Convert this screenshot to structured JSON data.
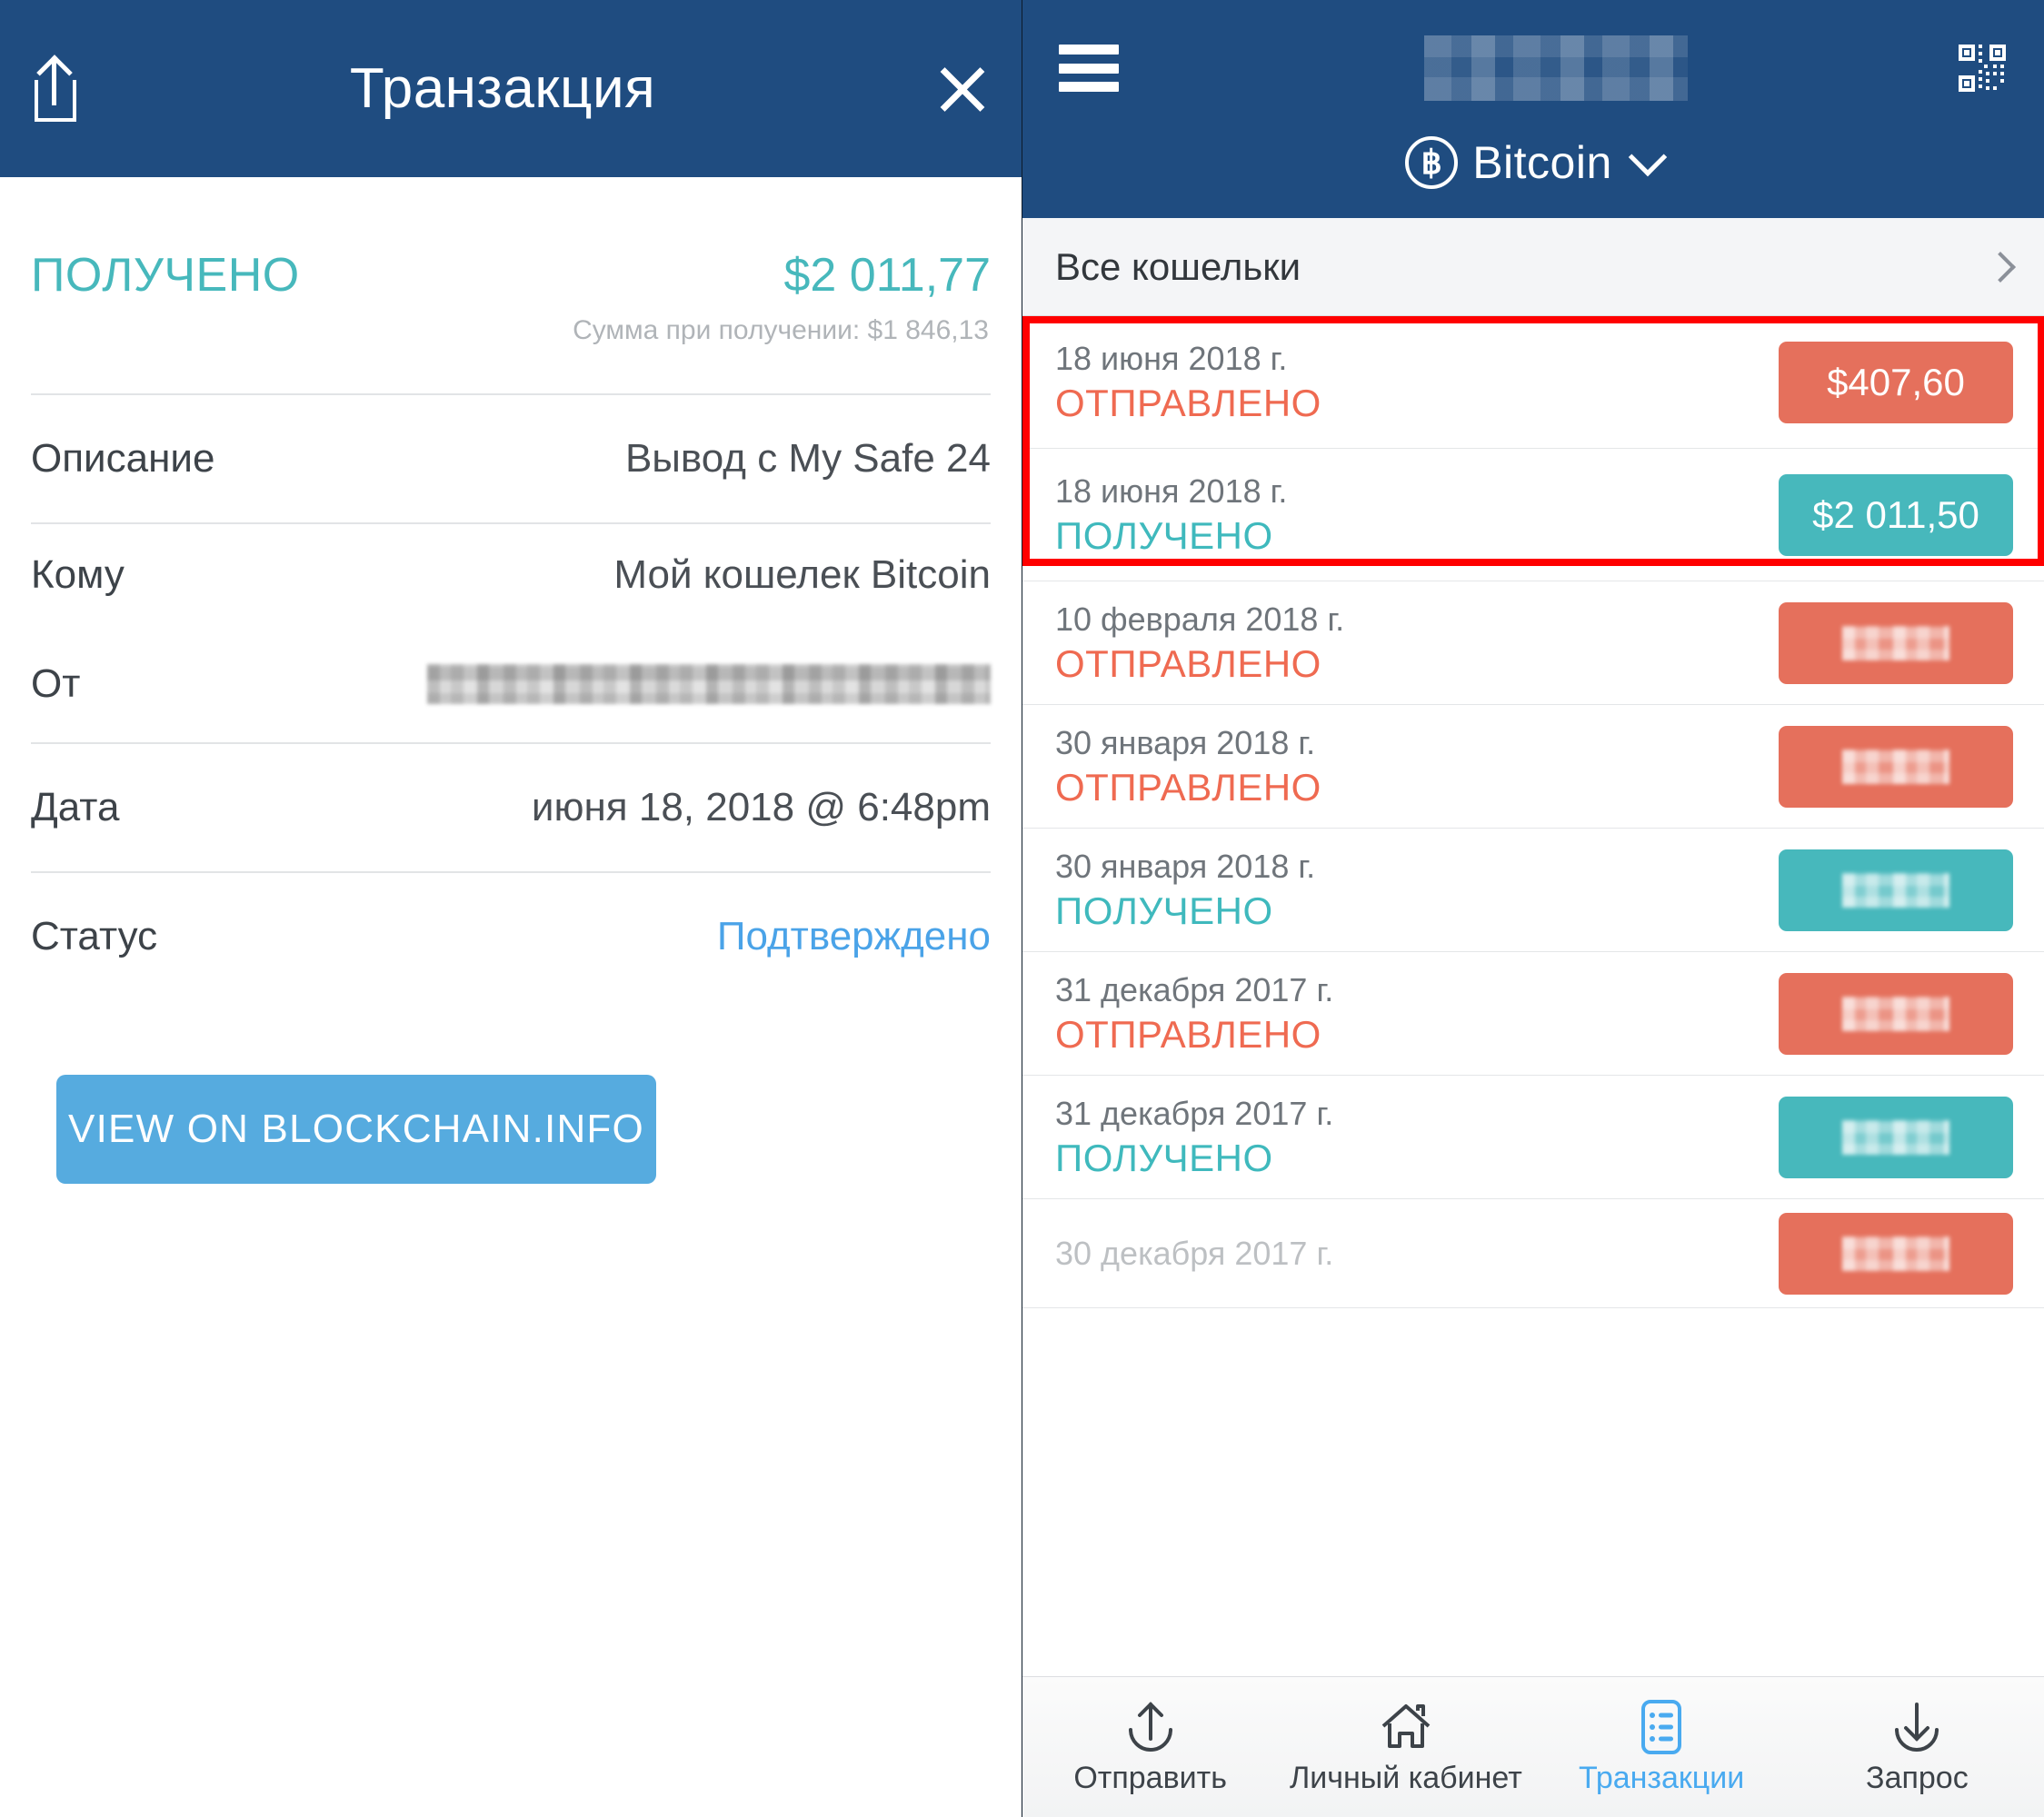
{
  "left": {
    "header": {
      "share_icon": "share-icon",
      "title": "Транзакция",
      "close_icon": "close-icon"
    },
    "summary": {
      "status_label": "ПОЛУЧЕНО",
      "amount": "$2 011,77",
      "sub_note": "Сумма при получении: $1 846,13"
    },
    "details": [
      {
        "label": "Описание",
        "value": "Вывод с My Safe 24",
        "type": "text"
      },
      {
        "label": "Кому",
        "value": "Мой кошелек Bitcoin",
        "type": "text"
      },
      {
        "label": "От",
        "value": "",
        "type": "blurred"
      },
      {
        "label": "Дата",
        "value": "июня 18, 2018 @ 6:48pm",
        "type": "text"
      },
      {
        "label": "Статус",
        "value": "Подтверждено",
        "type": "link"
      }
    ],
    "action_button": "VIEW ON BLOCKCHAIN.INFO"
  },
  "right": {
    "header": {
      "menu_icon": "hamburger-menu-icon",
      "account_title": "",
      "qr_icon": "qr-code-icon",
      "coin_icon": "bitcoin-icon",
      "coin_name": "Bitcoin",
      "coin_chevron": "chevron-down-icon"
    },
    "wallets_row": {
      "label": "Все кошельки",
      "chevron": "chevron-right-icon"
    },
    "transactions": [
      {
        "date": "18 июня 2018 г.",
        "type": "ОТПРАВЛЕНО",
        "direction": "sent",
        "amount": "$407,60",
        "blurred": false
      },
      {
        "date": "18 июня 2018 г.",
        "type": "ПОЛУЧЕНО",
        "direction": "received",
        "amount": "$2 011,50",
        "blurred": false
      },
      {
        "date": "10 февраля 2018 г.",
        "type": "ОТПРАВЛЕНО",
        "direction": "sent",
        "amount": "",
        "blurred": true
      },
      {
        "date": "30 января 2018 г.",
        "type": "ОТПРАВЛЕНО",
        "direction": "sent",
        "amount": "",
        "blurred": true
      },
      {
        "date": "30 января 2018 г.",
        "type": "ПОЛУЧЕНО",
        "direction": "received",
        "amount": "",
        "blurred": true
      },
      {
        "date": "31 декабря 2017 г.",
        "type": "ОТПРАВЛЕНО",
        "direction": "sent",
        "amount": "",
        "blurred": true
      },
      {
        "date": "31 декабря 2017 г.",
        "type": "ПОЛУЧЕНО",
        "direction": "received",
        "amount": "",
        "blurred": true
      },
      {
        "date": "30 декабря 2017 г.",
        "type": "",
        "direction": "sent",
        "amount": "",
        "blurred": true
      }
    ],
    "bottom_nav": [
      {
        "label": "Отправить",
        "icon": "arrow-up-send-icon",
        "active": false
      },
      {
        "label": "Личный кабинет",
        "icon": "home-icon",
        "active": false
      },
      {
        "label": "Транзакции",
        "icon": "list-icon",
        "active": true
      },
      {
        "label": "Запрос",
        "icon": "arrow-down-request-icon",
        "active": false
      }
    ]
  },
  "colors": {
    "header_blue": "#1F4C80",
    "teal": "#47B8BC",
    "salmon": "#E5705C",
    "link_blue": "#4AA3E8",
    "button_blue": "#56ABDF",
    "highlight_red": "#FF0000"
  }
}
